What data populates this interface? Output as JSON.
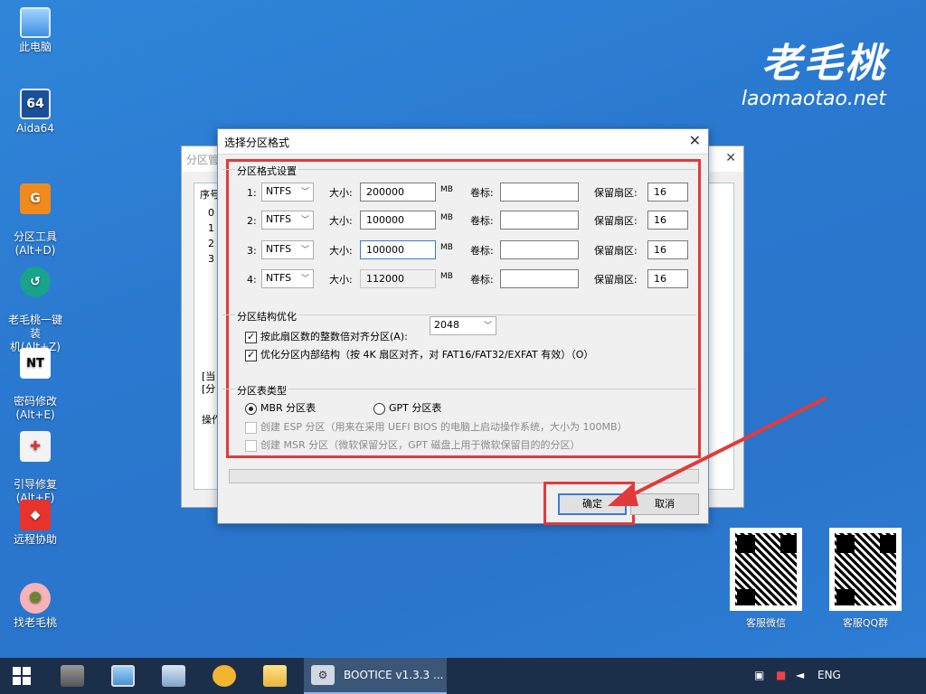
{
  "desktop": {
    "icons": [
      {
        "label": "此电脑",
        "icon": "computer-icon"
      },
      {
        "label": "Aida64",
        "icon": "aida64-icon",
        "glyph": "64"
      },
      {
        "label": "分区工具\n(Alt+D)",
        "icon": "partition-tool-icon",
        "glyph": "G"
      },
      {
        "label": "老毛桃一键装\n机(Alt+Z)",
        "icon": "installer-icon",
        "glyph": "↺"
      },
      {
        "label": "密码修改\n(Alt+E)",
        "icon": "password-icon",
        "glyph": "NT"
      },
      {
        "label": "引导修复\n(Alt+F)",
        "icon": "boot-repair-icon",
        "glyph": "✚"
      },
      {
        "label": "远程协助",
        "icon": "remote-assist-icon",
        "glyph": "◆"
      },
      {
        "label": "找老毛桃",
        "icon": "peach-icon",
        "glyph": "☻"
      }
    ],
    "logo_cn": "老毛桃",
    "logo_en": "laomaotao.net",
    "qr_codes": [
      {
        "label": "客服微信"
      },
      {
        "label": "客服QQ群"
      }
    ]
  },
  "bg_window": {
    "title": "分区管",
    "list_header": "序号",
    "rows": [
      "0",
      "1",
      "2",
      "3"
    ],
    "side_text_1": "[当",
    "side_text_2": "[分",
    "ops_label": "操作"
  },
  "dialog": {
    "title": "选择分区格式",
    "partition_settings": {
      "group_title": "分区格式设置",
      "size_label": "大小:",
      "unit": "MB",
      "volume_label": "卷标:",
      "reserved_label": "保留扇区:",
      "partitions": [
        {
          "index": "1:",
          "fs": "NTFS",
          "size": "200000",
          "volume": "",
          "reserved": "16"
        },
        {
          "index": "2:",
          "fs": "NTFS",
          "size": "100000",
          "volume": "",
          "reserved": "16"
        },
        {
          "index": "3:",
          "fs": "NTFS",
          "size": "100000",
          "volume": "",
          "reserved": "16"
        },
        {
          "index": "4:",
          "fs": "NTFS",
          "size": "112000",
          "volume": "",
          "reserved": "16"
        }
      ]
    },
    "structure": {
      "group_title": "分区结构优化",
      "align_label": "按此扇区数的整数倍对齐分区(A):",
      "align_value": "2048",
      "align_checked": true,
      "optimize_label": "优化分区内部结构（按 4K 扇区对齐，对 FAT16/FAT32/EXFAT 有效）（O）",
      "optimize_checked": true
    },
    "table_type": {
      "group_title": "分区表类型",
      "mbr_label": "MBR 分区表",
      "gpt_label": "GPT 分区表",
      "selected": "MBR",
      "esp_label": "创建 ESP 分区（用来在采用 UEFI BIOS 的电脑上启动操作系统，大小为 100MB）",
      "msr_label": "创建 MSR 分区（微软保留分区，GPT 磁盘上用于微软保留目的的分区）"
    },
    "ok_label": "确定",
    "cancel_label": "取消"
  },
  "taskbar": {
    "task_label": "BOOTICE v1.3.3 ...",
    "lang": "ENG"
  },
  "colors": {
    "desktop_bg": "#2a78cf",
    "highlight_red": "#e23a3a",
    "accent_blue": "#3d7bd6",
    "taskbar_bg": "#1c2f4a"
  }
}
